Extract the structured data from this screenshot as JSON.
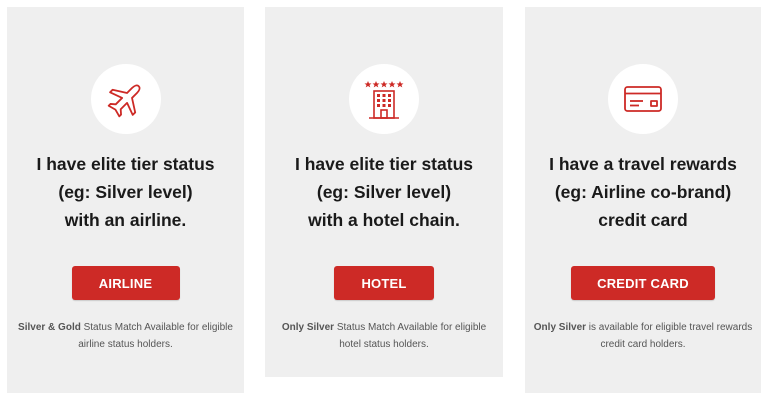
{
  "accent_color": "#cd2a26",
  "cards": [
    {
      "icon": "airplane-icon",
      "heading": [
        "I have elite tier status",
        "(eg: Silver level)",
        "with an airline."
      ],
      "button_label": "AIRLINE",
      "note_bold": "Silver & Gold",
      "note_text": " Status Match Available for eligible airline status holders."
    },
    {
      "icon": "hotel-icon",
      "heading": [
        "I have elite tier status",
        "(eg: Silver level)",
        "with a hotel chain."
      ],
      "button_label": "HOTEL",
      "note_bold": "Only Silver",
      "note_text": " Status Match Available for eligible hotel status holders."
    },
    {
      "icon": "credit-card-icon",
      "heading": [
        "I have a travel rewards",
        "(eg: Airline co-brand)",
        "credit card"
      ],
      "button_label": "CREDIT CARD",
      "note_bold": "Only Silver",
      "note_text": " is available for eligible travel rewards credit card holders."
    }
  ]
}
